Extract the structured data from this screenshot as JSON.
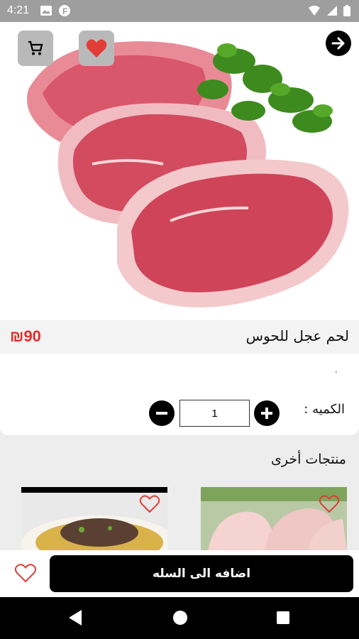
{
  "status_bar": {
    "time": "4:21",
    "left_icons": [
      "photo-icon",
      "f-icon"
    ],
    "right_icons": [
      "wifi-icon",
      "signal-icon",
      "battery-icon"
    ]
  },
  "header": {
    "cart_icon": "cart-icon",
    "favorite_icon": "heart-icon",
    "back_icon": "arrow-right-icon",
    "favorite_color": "#e33b35"
  },
  "product": {
    "title": "لحم عجل للحوس",
    "price": "₪90",
    "description": ".",
    "quantity_label": "الكميه :",
    "quantity_value": "1",
    "price_color": "#e32d2d"
  },
  "other_products": {
    "title": "منتجات أخرى",
    "items": [
      {
        "icon": "heart-outline-icon"
      },
      {
        "icon": "heart-outline-icon"
      }
    ]
  },
  "actions": {
    "add_to_cart_label": "اضافه الى السله",
    "favorite_icon": "heart-outline-icon"
  }
}
